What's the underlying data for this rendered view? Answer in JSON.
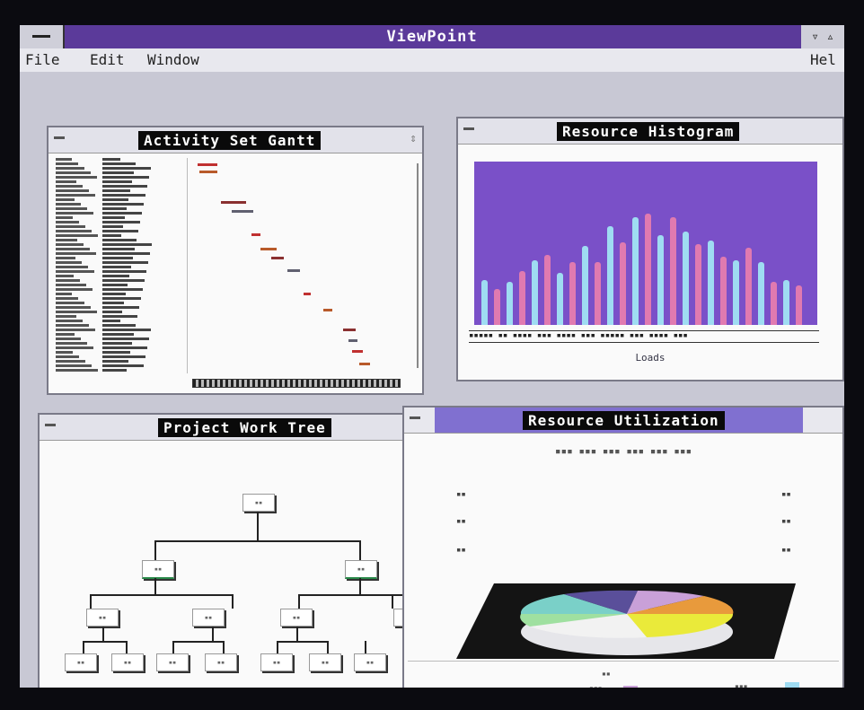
{
  "app": {
    "title": "ViewPoint"
  },
  "menu": [
    {
      "label": "File"
    },
    {
      "label": "Edit"
    },
    {
      "label": "Window"
    },
    {
      "label": "Hel"
    }
  ],
  "gantt": {
    "title": "Activity Set Gantt"
  },
  "histogram": {
    "title": "Resource Histogram",
    "xlabel": "Loads"
  },
  "tree": {
    "title": "Project Work Tree"
  },
  "utilization": {
    "title": "Resource Utilization"
  },
  "colors": {
    "accent": "#5b3a9a",
    "hist_bg": "#7a50c8",
    "bar_pink": "#e07ab0",
    "bar_cyan": "#9fdcf2"
  }
}
